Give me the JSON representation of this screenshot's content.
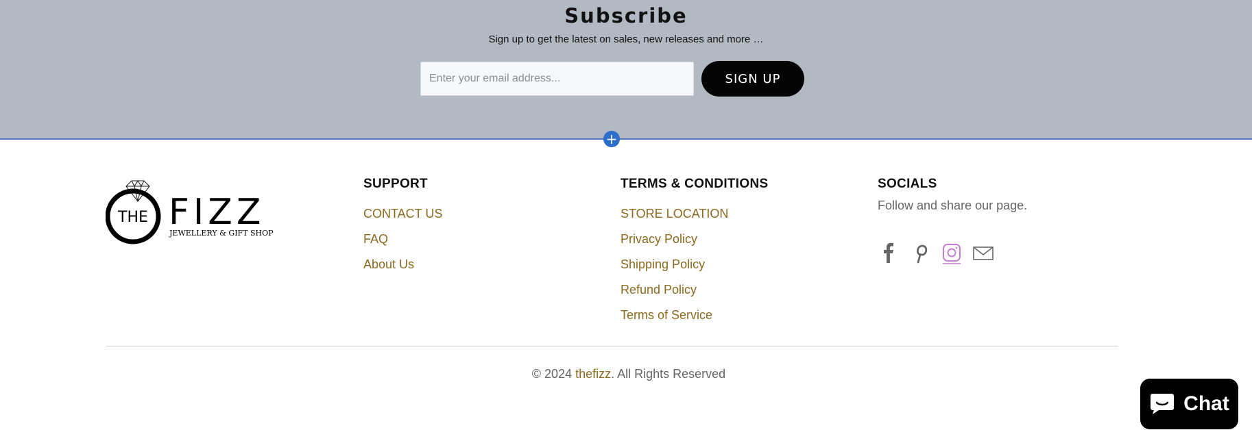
{
  "subscribe": {
    "title": "Subscribe",
    "subtitle": "Sign up to get the latest on sales, new releases and more …",
    "email_placeholder": "Enter your email address...",
    "signup_label": "SIGN UP",
    "add_label": "+"
  },
  "logo": {
    "the": "THE",
    "name": "FIZZ",
    "tagline": "JEWELLERY & GIFT SHOP"
  },
  "footer": {
    "support": {
      "heading": "SUPPORT",
      "links": [
        "CONTACT US",
        "FAQ",
        "About Us"
      ]
    },
    "terms": {
      "heading": "TERMS & CONDITIONS",
      "links": [
        "STORE LOCATION",
        "Privacy Policy",
        "Shipping Policy",
        "Refund Policy",
        "Terms of Service"
      ]
    },
    "socials": {
      "heading": "SOCIALS",
      "text": "Follow and share our page.",
      "icons": [
        "facebook-icon",
        "pinterest-icon",
        "instagram-icon",
        "email-icon"
      ]
    }
  },
  "copyright": {
    "prefix": "© 2024 ",
    "brand": "thefizz",
    "suffix": ". All Rights Reserved"
  },
  "chat": {
    "label": "Chat"
  },
  "colors": {
    "subscribe_bg": "#b3b9c3",
    "link": "#8a6a1e",
    "instagram": "#c77dd4",
    "accent_blue": "#2c6ecb"
  }
}
